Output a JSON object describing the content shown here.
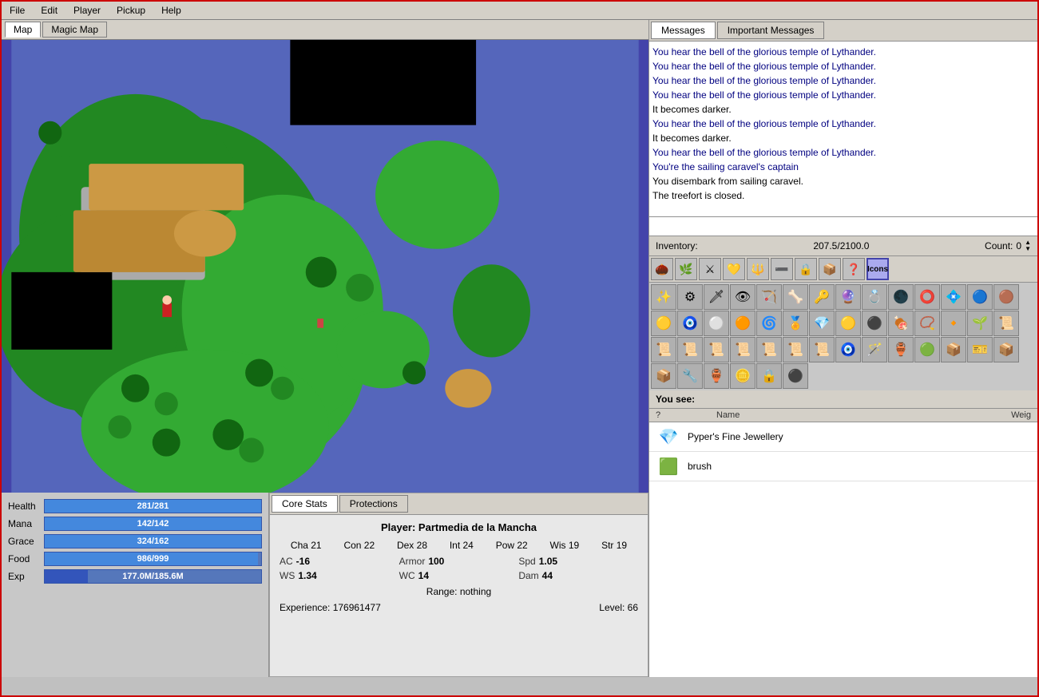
{
  "menu": {
    "items": [
      "File",
      "Edit",
      "Player",
      "Pickup",
      "Help"
    ]
  },
  "map_tabs": {
    "tabs": [
      "Map",
      "Magic Map"
    ],
    "active": "Map"
  },
  "messages": {
    "tabs": [
      "Messages",
      "Important Messages"
    ],
    "active": "Messages",
    "lines": [
      {
        "text": "You hear the bell of the glorious temple of Lythander.",
        "type": "blue"
      },
      {
        "text": "You hear the bell of the glorious temple of Lythander.",
        "type": "blue"
      },
      {
        "text": "You hear the bell of the glorious temple of Lythander.",
        "type": "blue"
      },
      {
        "text": "You hear the bell of the glorious temple of Lythander.",
        "type": "blue"
      },
      {
        "text": "It becomes darker.",
        "type": "dark"
      },
      {
        "text": "You hear the bell of the glorious temple of Lythander.",
        "type": "blue"
      },
      {
        "text": "It becomes darker.",
        "type": "dark"
      },
      {
        "text": "You hear the bell of the glorious temple of Lythander.",
        "type": "blue"
      },
      {
        "text": "You're the sailing caravel's captain",
        "type": "blue"
      },
      {
        "text": "You disembark from sailing caravel.",
        "type": "dark"
      },
      {
        "text": "The treefort is closed.",
        "type": "dark"
      }
    ]
  },
  "inventory": {
    "label": "Inventory:",
    "weight": "207.5/2100.0",
    "count_label": "Count:",
    "count": "0",
    "icons": [
      "🌰",
      "🌿",
      "⚔",
      "💛",
      "🔱",
      "➖",
      "🔒",
      "📦",
      "❓",
      "Icons"
    ],
    "items": [
      "✨",
      "⚙",
      "🗡",
      "👁",
      "🏹",
      "🦴",
      "🔑",
      "🔮",
      "💍",
      "🌑",
      "⭕",
      "💠",
      "🔵",
      "🟤",
      "🟡",
      "🧿",
      "⚪",
      "🟠",
      "🌀",
      "🏅",
      "💎",
      "🟡",
      "⚫",
      "🍖",
      "📿",
      "🔸",
      "🌱",
      "📜",
      "📜",
      "📜",
      "📜",
      "📜",
      "📜",
      "📜",
      "📜",
      "🧿",
      "🪄",
      "🏺",
      "🟢",
      "📦",
      "🎫",
      "📦",
      "📦",
      "🔧",
      "🏺",
      "🪙",
      "🔒",
      "⚫"
    ]
  },
  "you_see": {
    "label": "You see:",
    "columns": [
      "?",
      "Name",
      "Weig"
    ],
    "items": [
      {
        "icon": "💎",
        "name": "Pyper's Fine Jewellery",
        "weight": ""
      },
      {
        "icon": "🟩",
        "name": "brush",
        "weight": ""
      }
    ]
  },
  "stats": {
    "health": {
      "label": "Health",
      "current": 281,
      "max": 281,
      "display": "281/281"
    },
    "mana": {
      "label": "Mana",
      "current": 142,
      "max": 142,
      "display": "142/142"
    },
    "grace": {
      "label": "Grace",
      "current": 324,
      "max": 162,
      "display": "324/162"
    },
    "food": {
      "label": "Food",
      "current": 986,
      "max": 999,
      "display": "986/999"
    },
    "exp": {
      "label": "Exp",
      "current": 177,
      "max": 185.6,
      "display": "177.0M/185.6M"
    }
  },
  "char": {
    "tabs": [
      "Core Stats",
      "Protections"
    ],
    "active": "Core Stats",
    "player_name": "Player: Partmedia de la Mancha",
    "attrs": [
      {
        "name": "Cha",
        "val": "21"
      },
      {
        "name": "Con",
        "val": "22"
      },
      {
        "name": "Dex",
        "val": "28"
      },
      {
        "name": "Int",
        "val": "24"
      },
      {
        "name": "Pow",
        "val": "22"
      },
      {
        "name": "Wis",
        "val": "19"
      },
      {
        "name": "Str",
        "val": "19"
      }
    ],
    "core_stats": [
      {
        "name": "AC",
        "val": "-16"
      },
      {
        "name": "Armor",
        "val": "100"
      },
      {
        "name": "Spd",
        "val": "1.05"
      },
      {
        "name": "WS",
        "val": "1.34"
      },
      {
        "name": "WC",
        "val": "14"
      },
      {
        "name": "Dam",
        "val": "44"
      }
    ],
    "range": "Range: nothing",
    "experience": "Experience: 176961477",
    "level": "Level: 66"
  }
}
